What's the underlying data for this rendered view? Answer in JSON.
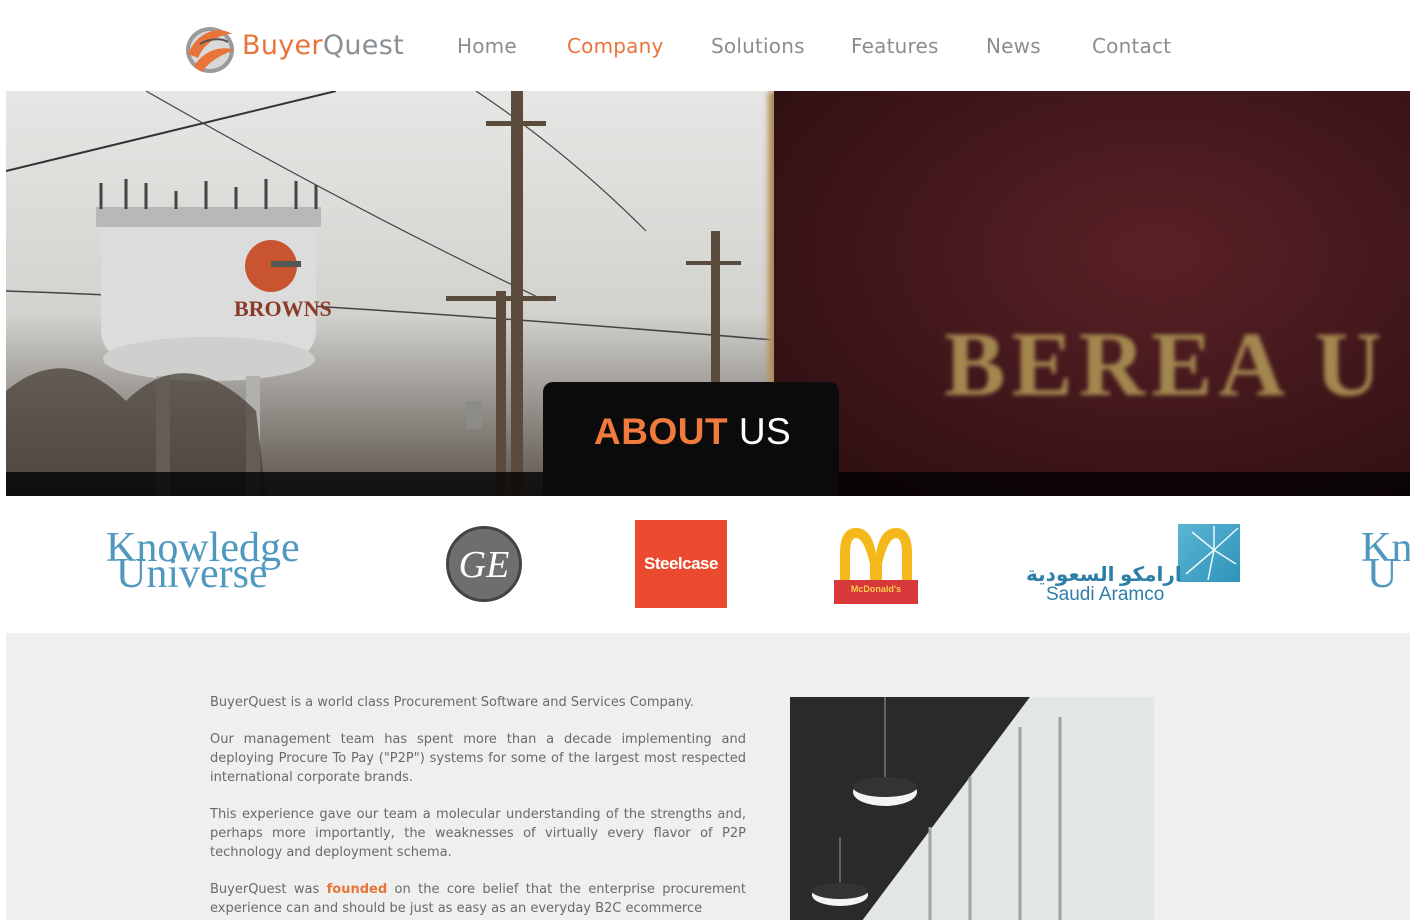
{
  "brand": {
    "part1": "Buyer",
    "part2": "Quest",
    "accent": "#e8743b",
    "gray": "#8a8f93"
  },
  "nav": [
    {
      "label": "Home",
      "active": false
    },
    {
      "label": "Company",
      "active": true
    },
    {
      "label": "Solutions",
      "active": false
    },
    {
      "label": "Features",
      "active": false
    },
    {
      "label": "News",
      "active": false
    },
    {
      "label": "Contact",
      "active": false
    }
  ],
  "hero": {
    "title_highlight": "ABOUT",
    "title_rest": "US",
    "sign_text": "BEREA U",
    "tower_text": "BROWNS"
  },
  "clients": {
    "knowledge_universe_l1": "Knowledge",
    "knowledge_universe_l2": "Universe",
    "ge": "GE",
    "steelcase": "Steelcase",
    "mcdonalds": "McDonald's",
    "aramco_ar": "ارامكو السعودية",
    "aramco_en": "Saudi Aramco",
    "knowledge_universe_partial_l1": "Kn",
    "knowledge_universe_partial_l2": "U"
  },
  "about": {
    "p1": "BuyerQuest is a world class Procurement Software and Services Company.",
    "p2": "Our management team has spent more than a decade implementing and deploying Procure To Pay (\"P2P\") systems for some of the largest most respected international corporate brands.",
    "p3": "This experience gave our team a molecular understanding of the strengths and, perhaps more importantly, the weaknesses of virtually every flavor of P2P technology and deployment schema.",
    "p4_pre": "BuyerQuest was ",
    "p4_highlight": "founded",
    "p4_post": " on the core belief that the enterprise procurement experience can and should be just as easy as an everyday B2C ecommerce"
  }
}
